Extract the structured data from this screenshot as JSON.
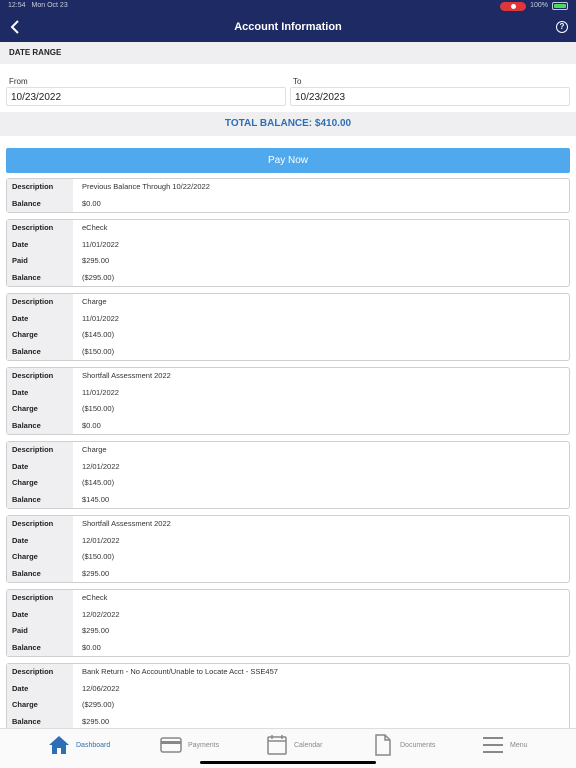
{
  "status": {
    "time": "12:54",
    "date": "Mon Oct 23",
    "battery": "100%"
  },
  "nav": {
    "title": "Account Information"
  },
  "date_range": {
    "heading": "DATE RANGE",
    "from_label": "From",
    "from_value": "10/23/2022",
    "to_label": "To",
    "to_value": "10/23/2023"
  },
  "total": {
    "text": "TOTAL BALANCE: $410.00"
  },
  "pay_button": "Pay Now",
  "ledger": [
    {
      "rows": [
        {
          "label": "Description",
          "value": "Previous Balance Through 10/22/2022"
        },
        {
          "label": "Balance",
          "value": "$0.00"
        }
      ]
    },
    {
      "rows": [
        {
          "label": "Description",
          "value": "eCheck"
        },
        {
          "label": "Date",
          "value": "11/01/2022"
        },
        {
          "label": "Paid",
          "value": "$295.00"
        },
        {
          "label": "Balance",
          "value": "($295.00)"
        }
      ]
    },
    {
      "rows": [
        {
          "label": "Description",
          "value": "Charge"
        },
        {
          "label": "Date",
          "value": "11/01/2022"
        },
        {
          "label": "Charge",
          "value": "($145.00)"
        },
        {
          "label": "Balance",
          "value": "($150.00)"
        }
      ]
    },
    {
      "rows": [
        {
          "label": "Description",
          "value": "Shortfall Assessment 2022"
        },
        {
          "label": "Date",
          "value": "11/01/2022"
        },
        {
          "label": "Charge",
          "value": "($150.00)"
        },
        {
          "label": "Balance",
          "value": "$0.00"
        }
      ]
    },
    {
      "rows": [
        {
          "label": "Description",
          "value": "Charge"
        },
        {
          "label": "Date",
          "value": "12/01/2022"
        },
        {
          "label": "Charge",
          "value": "($145.00)"
        },
        {
          "label": "Balance",
          "value": "$145.00"
        }
      ]
    },
    {
      "rows": [
        {
          "label": "Description",
          "value": "Shortfall Assessment 2022"
        },
        {
          "label": "Date",
          "value": "12/01/2022"
        },
        {
          "label": "Charge",
          "value": "($150.00)"
        },
        {
          "label": "Balance",
          "value": "$295.00"
        }
      ]
    },
    {
      "rows": [
        {
          "label": "Description",
          "value": "eCheck"
        },
        {
          "label": "Date",
          "value": "12/02/2022"
        },
        {
          "label": "Paid",
          "value": "$295.00"
        },
        {
          "label": "Balance",
          "value": "$0.00"
        }
      ]
    },
    {
      "rows": [
        {
          "label": "Description",
          "value": "Bank Return - No Account/Unable to Locate Acct - SSE457"
        },
        {
          "label": "Date",
          "value": "12/06/2022"
        },
        {
          "label": "Charge",
          "value": "($295.00)"
        },
        {
          "label": "Balance",
          "value": "$295.00"
        }
      ]
    }
  ],
  "tabs": [
    {
      "label": "Dashboard",
      "icon": "home-icon",
      "active": true
    },
    {
      "label": "Payments",
      "icon": "credit-card-icon",
      "active": false
    },
    {
      "label": "Calendar",
      "icon": "calendar-icon",
      "active": false
    },
    {
      "label": "Documents",
      "icon": "document-icon",
      "active": false
    },
    {
      "label": "Menu",
      "icon": "menu-icon",
      "active": false
    }
  ],
  "colors": {
    "nav": "#1e2a63",
    "accent": "#2d6fb7",
    "pay_button": "#4fa9ec"
  }
}
